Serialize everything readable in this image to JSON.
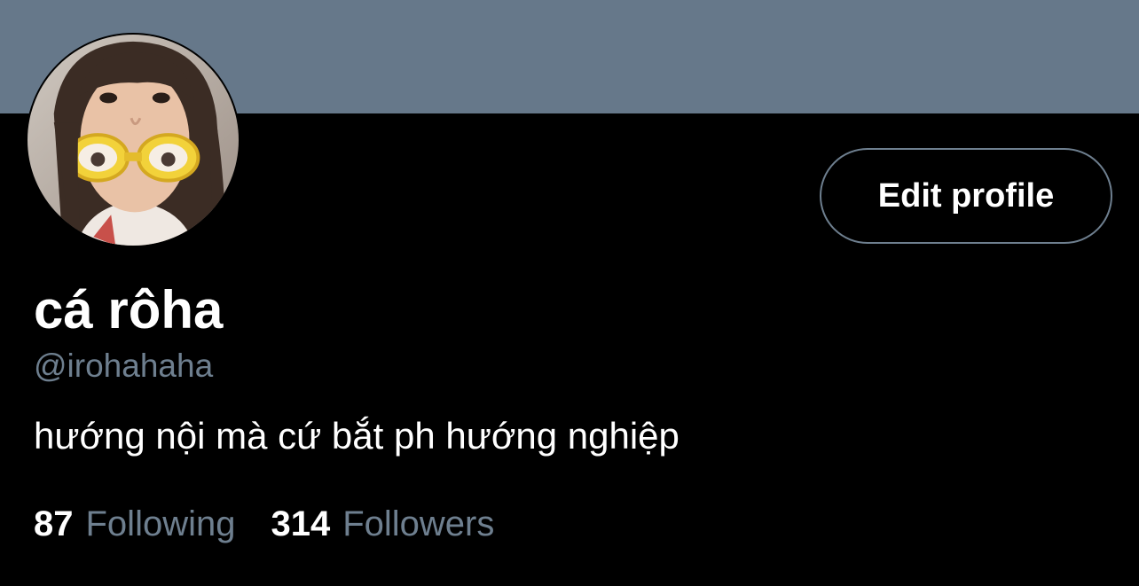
{
  "profile": {
    "display_name": "cá rôha",
    "handle": "@irohahaha",
    "bio": "hướng nội mà cứ bắt ph hướng nghiệp",
    "avatar_icon": "profile-photo"
  },
  "actions": {
    "edit_profile_label": "Edit profile"
  },
  "stats": {
    "following_count": "87",
    "following_label": "Following",
    "followers_count": "314",
    "followers_label": "Followers"
  },
  "colors": {
    "background": "#000000",
    "banner": "#66788a",
    "primary_text": "#ffffff",
    "secondary_text": "#6e7f8f",
    "button_border": "#6e7f8f"
  }
}
